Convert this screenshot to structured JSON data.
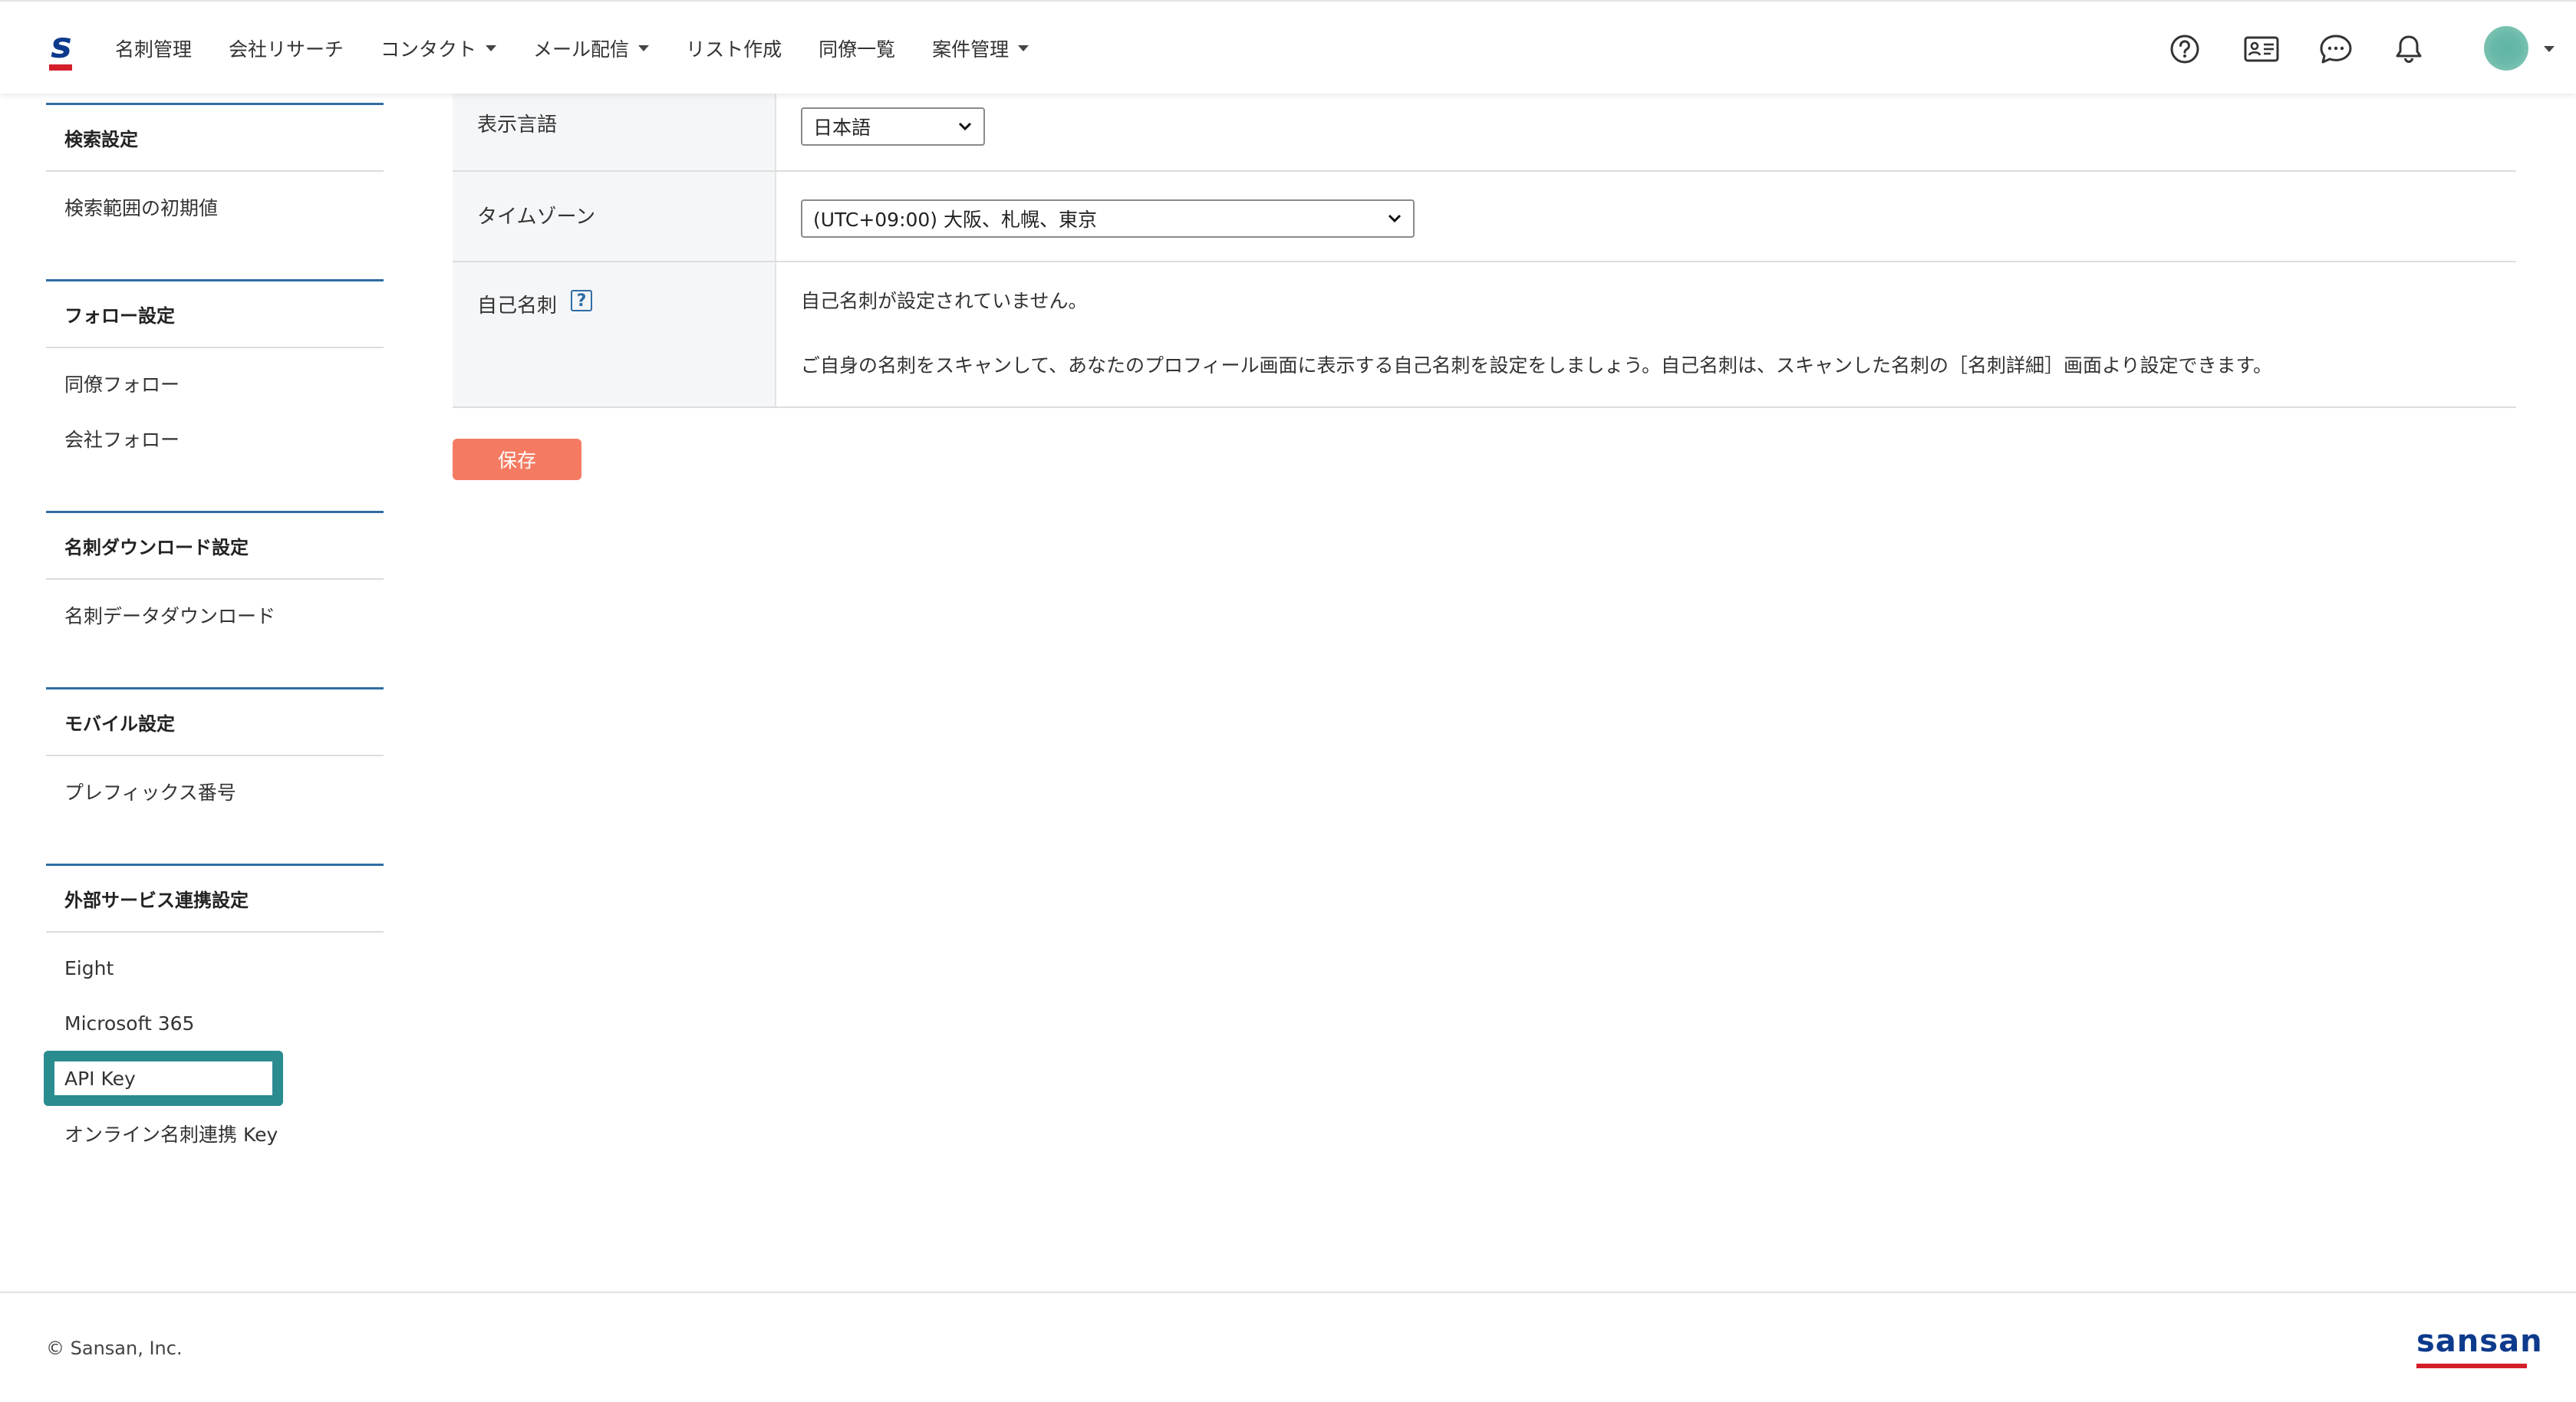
{
  "header": {
    "logo_letter": "s",
    "nav": [
      {
        "label": "名刺管理",
        "dropdown": false
      },
      {
        "label": "会社リサーチ",
        "dropdown": false
      },
      {
        "label": "コンタクト",
        "dropdown": true
      },
      {
        "label": "メール配信",
        "dropdown": true
      },
      {
        "label": "リスト作成",
        "dropdown": false
      },
      {
        "label": "同僚一覧",
        "dropdown": false
      },
      {
        "label": "案件管理",
        "dropdown": true
      }
    ],
    "icons": [
      "help-circle-icon",
      "business-card-icon",
      "chat-bubble-icon",
      "bell-icon"
    ]
  },
  "sidebar": {
    "sections": [
      {
        "title": "検索設定",
        "items": [
          "検索範囲の初期値"
        ]
      },
      {
        "title": "フォロー設定",
        "items": [
          "同僚フォロー",
          "会社フォロー"
        ]
      },
      {
        "title": "名刺ダウンロード設定",
        "items": [
          "名刺データダウンロード"
        ]
      },
      {
        "title": "モバイル設定",
        "items": [
          "プレフィックス番号"
        ]
      },
      {
        "title": "外部サービス連携設定",
        "items": [
          "Eight",
          "Microsoft 365",
          "API Key",
          "オンライン名刺連携 Key"
        ]
      }
    ],
    "highlighted_item": "API Key"
  },
  "settings": {
    "language": {
      "label": "表示言語",
      "selected": "日本語"
    },
    "timezone": {
      "label": "タイムゾーン",
      "selected": "(UTC+09:00) 大阪、札幌、東京"
    },
    "self_card": {
      "label": "自己名刺",
      "help_glyph": "?",
      "line1": "自己名刺が設定されていません。",
      "line2": "ご自身の名刺をスキャンして、あなたのプロフィール画面に表示する自己名刺を設定をしましょう。自己名刺は、スキャンした名刺の［名刺詳細］画面より設定できます。"
    },
    "save_label": "保存"
  },
  "footer": {
    "copyright": "© Sansan, Inc.",
    "brand": "sansan"
  },
  "colors": {
    "accent_blue": "#2e6da4",
    "save_button": "#f47b62",
    "highlight": "#2b8c8f",
    "brand_red": "#d41e2a",
    "brand_navy": "#0d3a8c"
  }
}
